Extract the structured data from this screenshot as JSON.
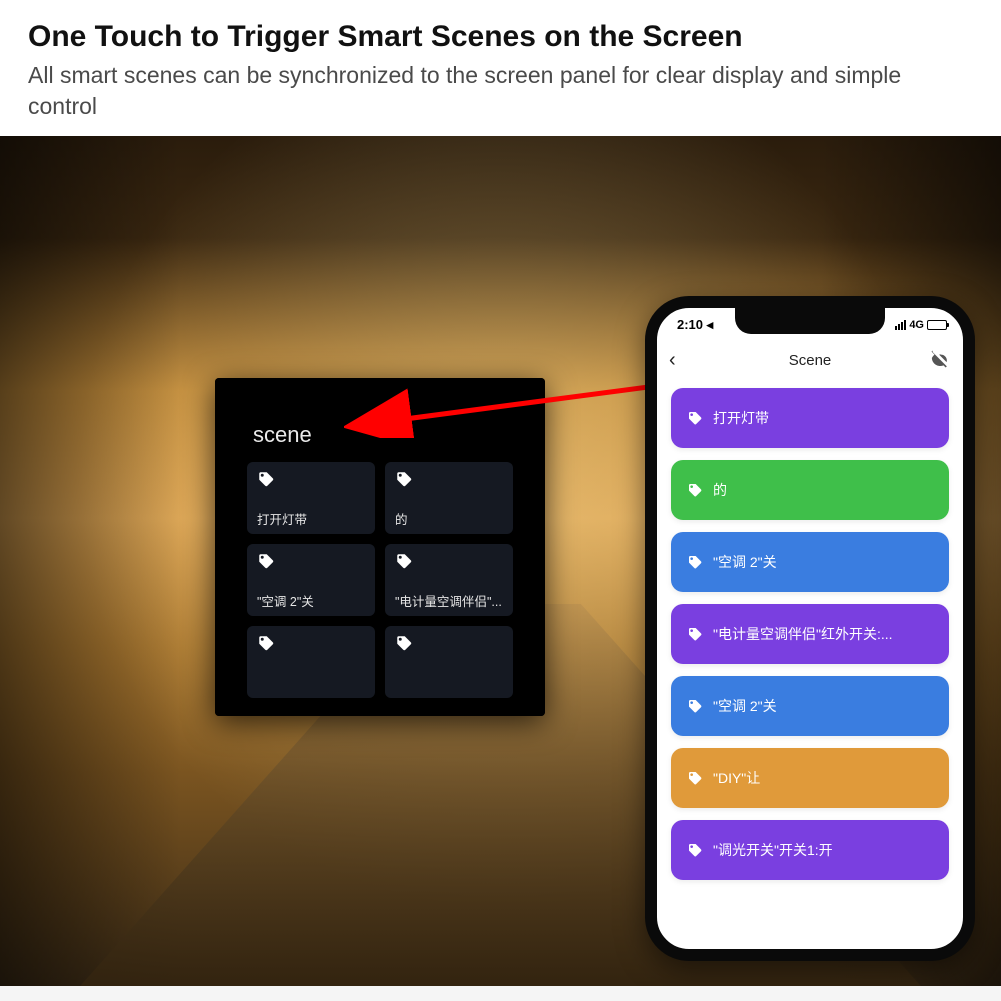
{
  "header": {
    "title": "One Touch to Trigger Smart Scenes on the Screen",
    "subtitle": "All smart scenes can be synchronized to the screen panel for clear display and simple control"
  },
  "panel": {
    "title": "scene",
    "tiles": [
      {
        "label": "打开灯带"
      },
      {
        "label": "的"
      },
      {
        "label": "\"空调 2\"关"
      },
      {
        "label": "\"电计量空调伴侣\"..."
      },
      {
        "label": ""
      },
      {
        "label": ""
      }
    ]
  },
  "phone": {
    "status_time": "2:10",
    "status_network": "4G",
    "screen_title": "Scene",
    "scenes": [
      {
        "label": "打开灯带",
        "color": "#7a3fe0"
      },
      {
        "label": "的",
        "color": "#3fbf4a"
      },
      {
        "label": "\"空调 2\"关",
        "color": "#3a7de0"
      },
      {
        "label": "\"电计量空调伴侣\"红外开关:...",
        "color": "#7a3fe0"
      },
      {
        "label": "\"空调 2\"关",
        "color": "#3a7de0"
      },
      {
        "label": "\"DIY\"让",
        "color": "#e09a3a"
      },
      {
        "label": "\"调光开关\"开关1:开",
        "color": "#7a3fe0"
      }
    ]
  }
}
